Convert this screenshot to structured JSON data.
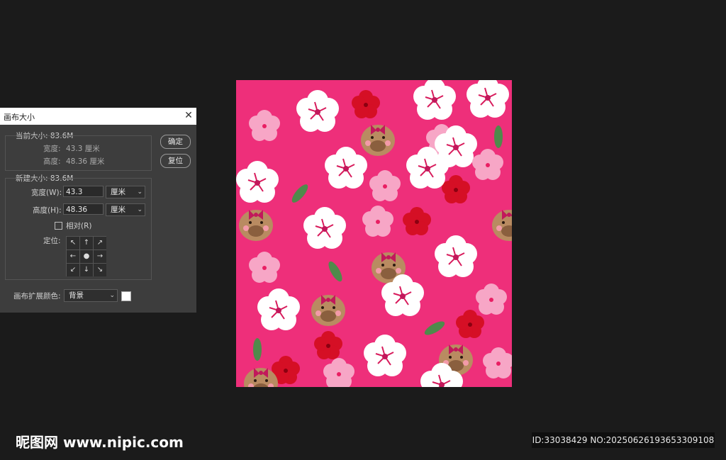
{
  "dialog": {
    "title": "画布大小",
    "current": {
      "header": "当前大小: 83.6M",
      "width_label": "宽度:",
      "width_value": "43.3 厘米",
      "height_label": "高度:",
      "height_value": "48.36 厘米"
    },
    "new": {
      "header": "新建大小: 83.6M",
      "width_label": "宽度(W):",
      "width_value": "43.3",
      "width_unit": "厘米",
      "height_label": "高度(H):",
      "height_value": "48.36",
      "height_unit": "厘米",
      "relative_label": "相对(R)",
      "relative_checked": false,
      "anchor_label": "定位:"
    },
    "extension_label": "画布扩展颜色:",
    "extension_value": "背景",
    "extension_color": "#ffffff",
    "ok_label": "确定",
    "reset_label": "复位"
  },
  "canvas": {
    "background_color": "#ee2f7a",
    "description_icon": "hibiscus-capybara-pattern"
  },
  "watermark": {
    "left": "昵图网 www.nipic.com",
    "right": "ID:33038429 NO:20250626193653309108"
  }
}
